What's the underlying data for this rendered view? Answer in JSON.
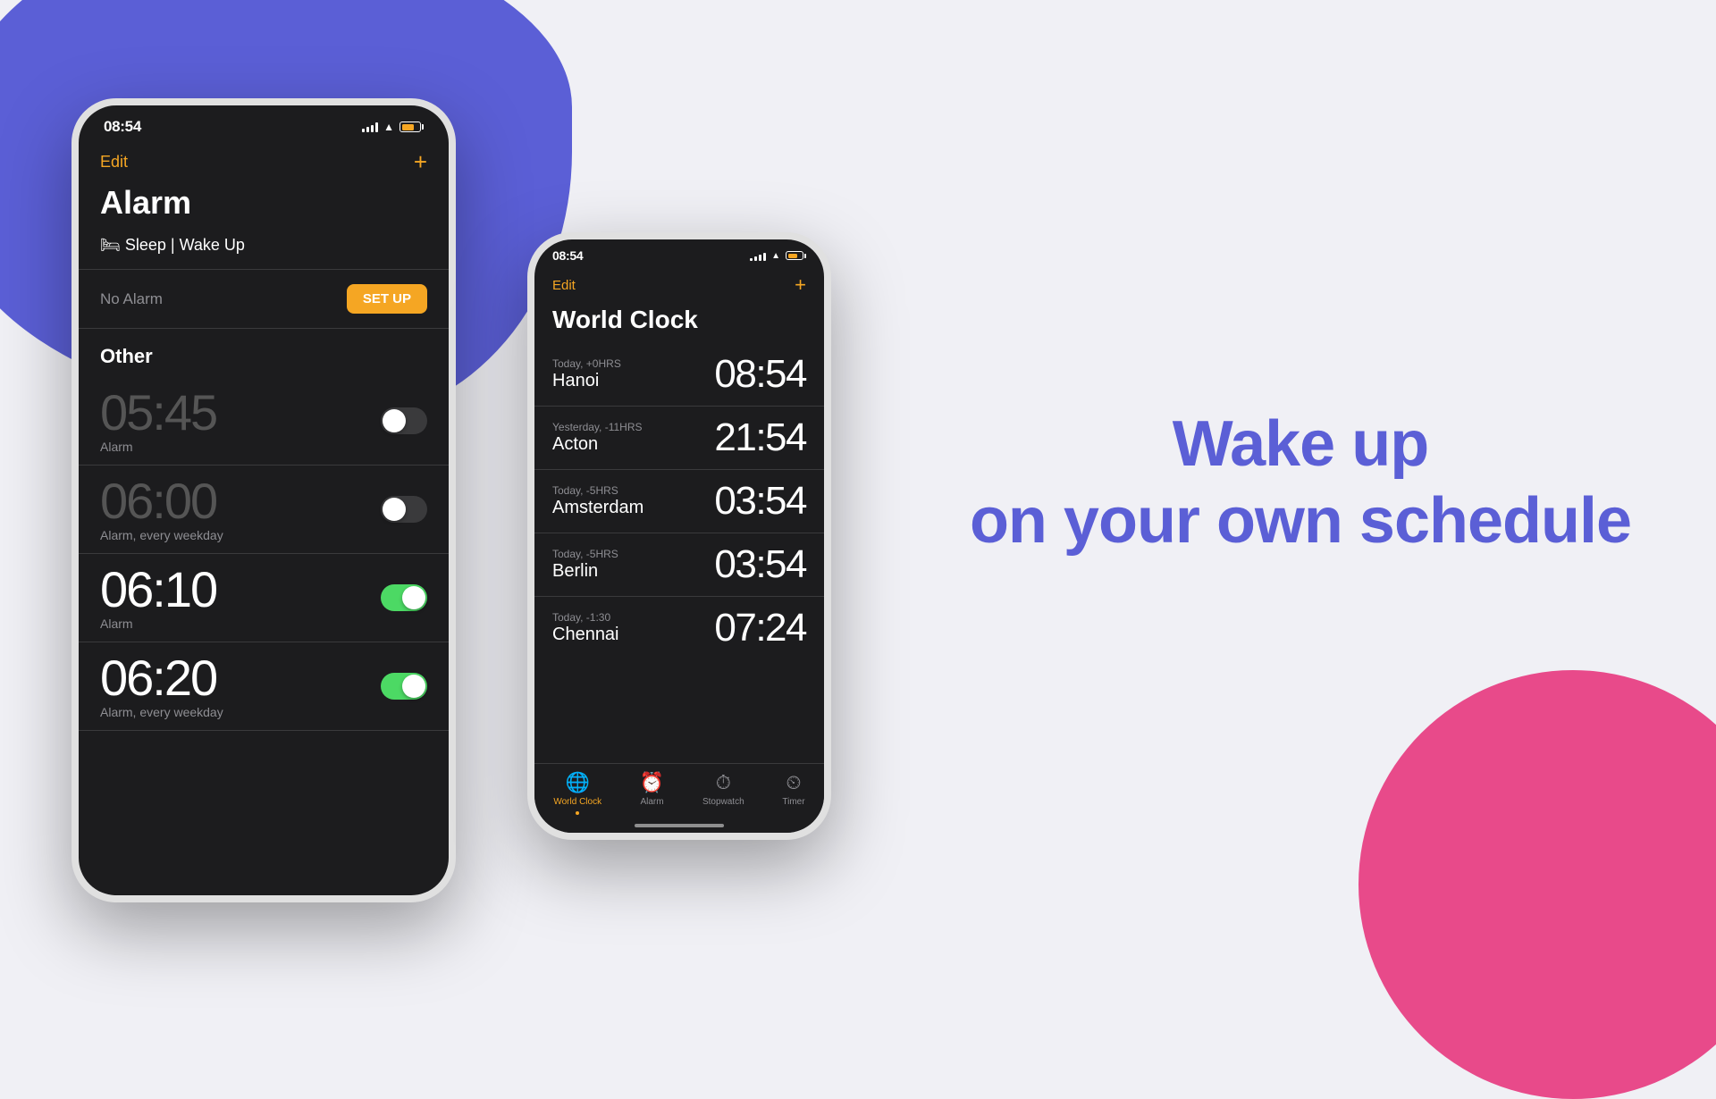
{
  "background": {
    "blue_blob_color": "#5b5fd6",
    "pink_blob_color": "#e84a8a",
    "page_bg": "#f0f0f5"
  },
  "hero": {
    "line1": "Wake up",
    "line2": "on your own schedule"
  },
  "phone_alarm": {
    "status_bar": {
      "time": "08:54"
    },
    "edit_label": "Edit",
    "add_label": "+",
    "title": "Alarm",
    "sleep_label": "🛏 Sleep | Wake Up",
    "no_alarm_text": "No Alarm",
    "setup_button": "SET UP",
    "other_title": "Other",
    "alarms": [
      {
        "time": "05:45",
        "label": "Alarm",
        "active": false
      },
      {
        "time": "06:00",
        "label": "Alarm, every weekday",
        "active": false
      },
      {
        "time": "06:10",
        "label": "Alarm",
        "active": true
      },
      {
        "time": "06:20",
        "label": "Alarm, every weekday",
        "active": true
      }
    ]
  },
  "phone_worldclock": {
    "status_bar": {
      "time": "08:54"
    },
    "edit_label": "Edit",
    "add_label": "+",
    "title": "World Clock",
    "cities": [
      {
        "offset": "Today, +0HRS",
        "city": "Hanoi",
        "time": "08:54"
      },
      {
        "offset": "Yesterday, -11HRS",
        "city": "Acton",
        "time": "21:54"
      },
      {
        "offset": "Today, -5HRS",
        "city": "Amsterdam",
        "time": "03:54"
      },
      {
        "offset": "Today, -5HRS",
        "city": "Berlin",
        "time": "03:54"
      },
      {
        "offset": "Today, -1:30",
        "city": "Chennai",
        "time": "07:24"
      }
    ],
    "tabs": [
      {
        "icon": "🌐",
        "label": "World Clock",
        "active": true
      },
      {
        "icon": "⏰",
        "label": "Alarm",
        "active": false
      },
      {
        "icon": "⏱",
        "label": "Stopwatch",
        "active": false
      },
      {
        "icon": "⏲",
        "label": "Timer",
        "active": false
      }
    ]
  }
}
